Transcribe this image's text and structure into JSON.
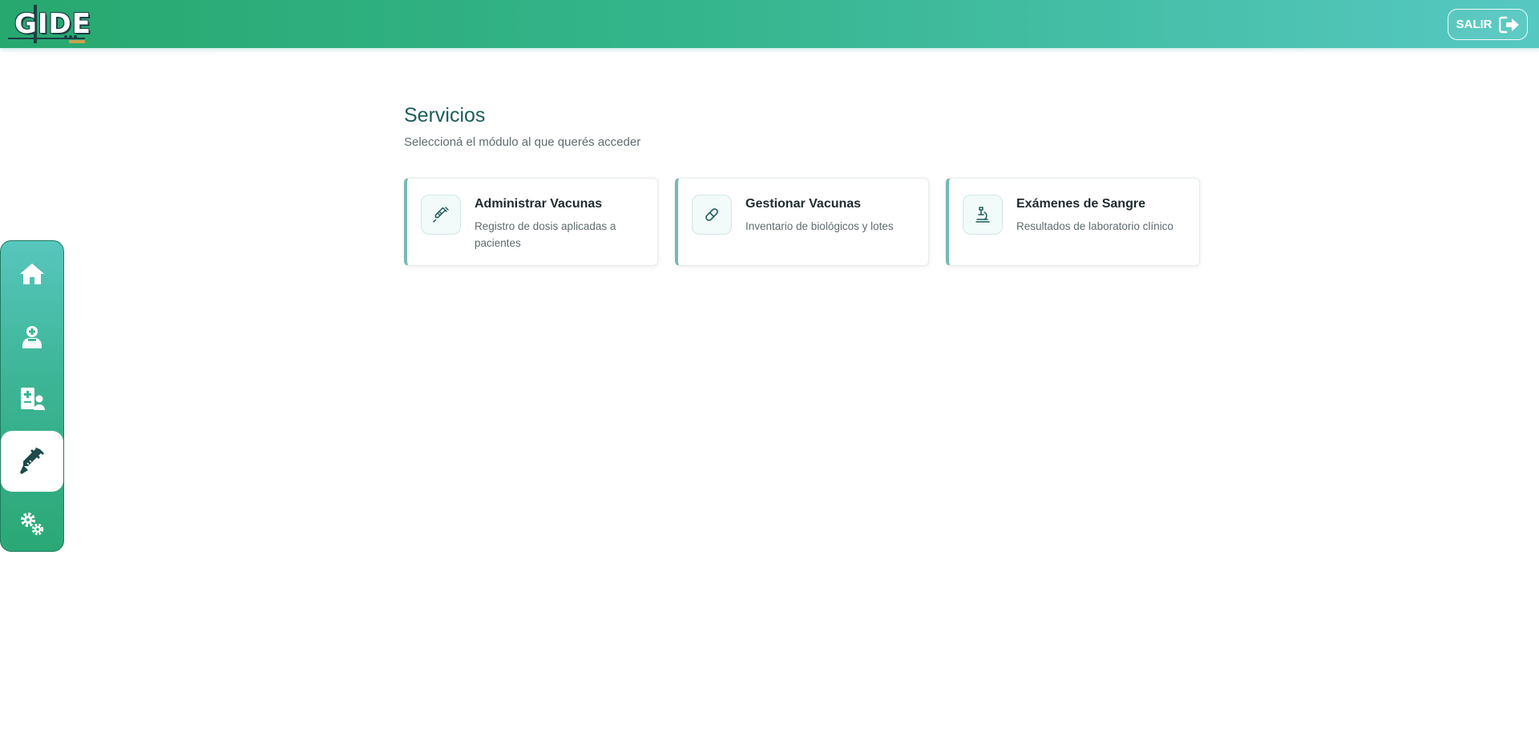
{
  "header": {
    "logo_text": "GIDE",
    "logout_label": "SALIR",
    "gradient_colors": [
      "#27a86f",
      "#56c8c2"
    ]
  },
  "sidebar": {
    "items": [
      {
        "name": "home",
        "icon": "home-icon",
        "active": false
      },
      {
        "name": "doctor",
        "icon": "doctor-icon",
        "active": false
      },
      {
        "name": "patients",
        "icon": "patient-file-icon",
        "active": false
      },
      {
        "name": "vaccines",
        "icon": "syringe-icon",
        "active": true
      },
      {
        "name": "settings",
        "icon": "gears-icon",
        "active": false
      }
    ]
  },
  "main": {
    "title": "Servicios",
    "subtitle": "Seleccioná el módulo al que querés acceder",
    "cards": [
      {
        "title": "Administrar Vacunas",
        "description": "Registro de dosis aplicadas a pacientes",
        "icon": "syringe-icon"
      },
      {
        "title": "Gestionar Vacunas",
        "description": "Inventario de biológicos y lotes",
        "icon": "pill-icon"
      },
      {
        "title": "Exámenes de Sangre",
        "description": "Resultados de laboratorio clínico",
        "icon": "microscope-icon"
      }
    ]
  },
  "colors": {
    "accent": "#1b5e5a",
    "card_border": "#76b9b5"
  }
}
